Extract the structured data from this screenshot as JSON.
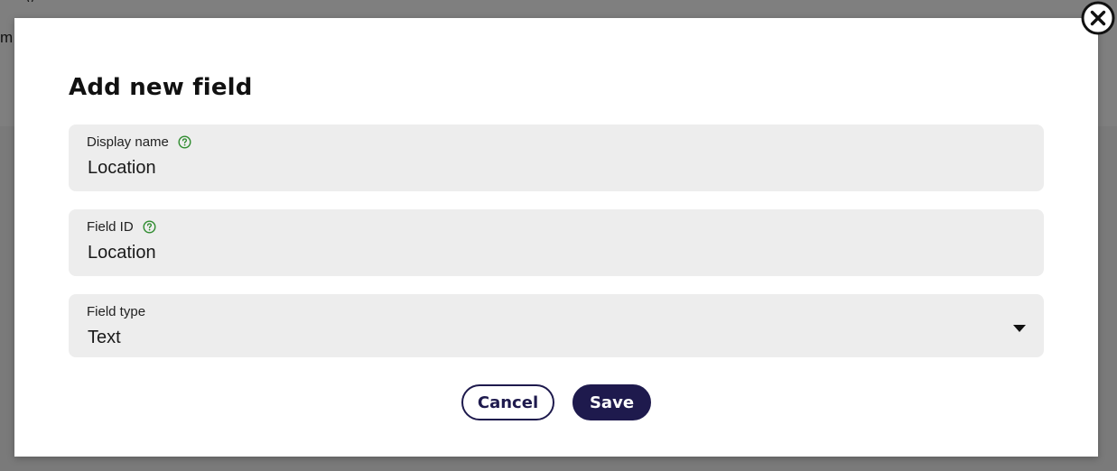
{
  "background": {
    "fragment_left": "m",
    "fragment_top": "y"
  },
  "modal": {
    "title": "Add new field",
    "close_icon": "close-circle-icon",
    "fields": {
      "display_name": {
        "label": "Display name",
        "value": "Location",
        "help_icon": "question-circle-icon"
      },
      "field_id": {
        "label": "Field ID",
        "value": "Location",
        "help_icon": "question-circle-icon"
      },
      "field_type": {
        "label": "Field type",
        "value": "Text",
        "dropdown_icon": "caret-down-icon"
      }
    },
    "actions": {
      "cancel_label": "Cancel",
      "save_label": "Save"
    }
  },
  "colors": {
    "primary": "#1e1a4d",
    "help_icon": "#2e8b2e",
    "field_background": "#ededed",
    "overlay": "#7d7d7d"
  }
}
